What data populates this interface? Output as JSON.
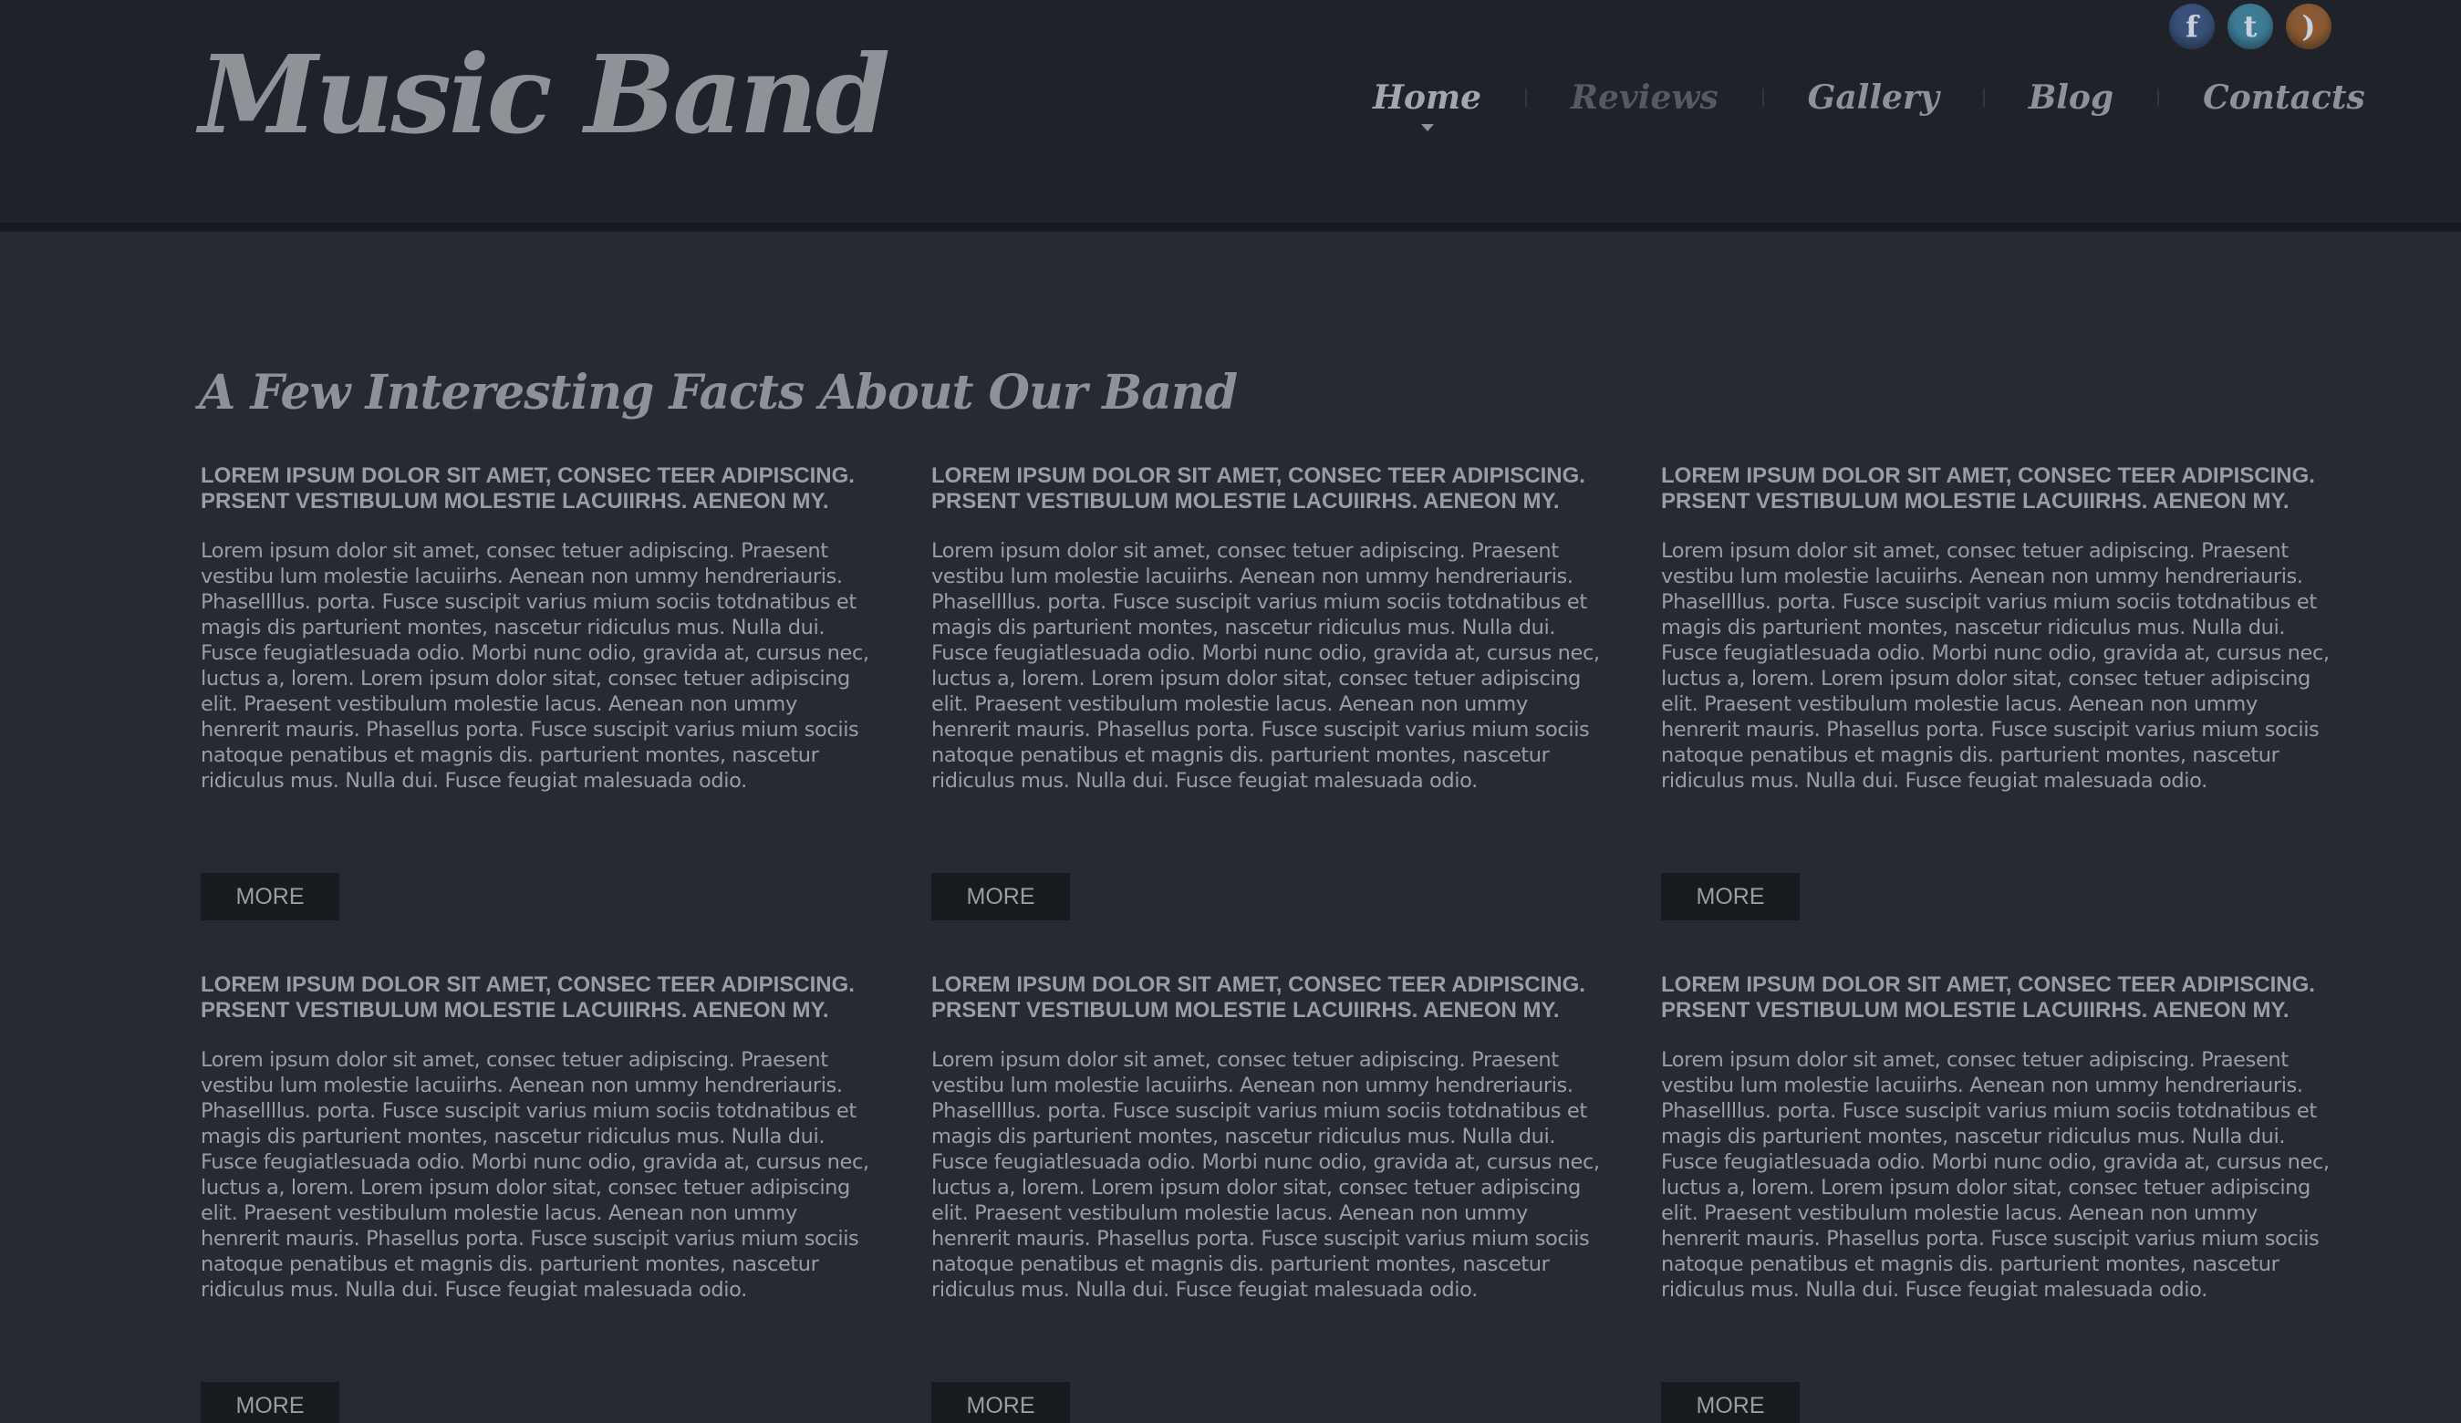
{
  "header": {
    "logo": "Music Band",
    "social": [
      {
        "icon": "facebook-icon",
        "glyph": "f"
      },
      {
        "icon": "twitter-icon",
        "glyph": "t"
      },
      {
        "icon": "rss-icon",
        "glyph": ")"
      }
    ],
    "nav": [
      {
        "label": "Home",
        "active": true
      },
      {
        "label": "Reviews",
        "active": false
      },
      {
        "label": "Gallery",
        "active": false
      },
      {
        "label": "Blog",
        "active": false
      },
      {
        "label": "Contacts",
        "active": false
      }
    ]
  },
  "main": {
    "heading": "A Few Interesting Facts About Our Band",
    "cards": [
      {
        "title": "LOREM IPSUM DOLOR SIT AMET, CONSEC TEER ADIPISCING. PRSENT VESTIBULUM MOLESTIE LACUIIRHS. AENEON MY.",
        "text": "Lorem ipsum dolor sit amet, consec tetuer adipiscing. Praesent vestibu lum molestie lacuiirhs. Aenean non ummy hendreriauris. Phasellllus. porta. Fusce suscipit varius mium sociis totdnatibus et magis dis parturient montes, nascetur ridiculus mus. Nulla dui. Fusce feugiatlesuada odio. Morbi nunc odio, gravida at, cursus nec, luctus a, lorem. Lorem ipsum dolor sitat, consec tetuer adipiscing elit. Praesent vestibulum molestie lacus. Aenean non ummy henrerit mauris. Phasellus porta. Fusce suscipit varius mium sociis natoque penatibus et magnis dis. parturient montes, nascetur ridiculus mus. Nulla dui. Fusce feugiat malesuada odio.",
        "button": "MORE"
      },
      {
        "title": "LOREM IPSUM DOLOR SIT AMET, CONSEC TEER ADIPISCING. PRSENT VESTIBULUM MOLESTIE LACUIIRHS. AENEON MY.",
        "text": "Lorem ipsum dolor sit amet, consec tetuer adipiscing. Praesent vestibu lum molestie lacuiirhs. Aenean non ummy hendreriauris. Phasellllus. porta. Fusce suscipit varius mium sociis totdnatibus et magis dis parturient montes, nascetur ridiculus mus. Nulla dui. Fusce feugiatlesuada odio. Morbi nunc odio, gravida at, cursus nec, luctus a, lorem. Lorem ipsum dolor sitat, consec tetuer adipiscing elit. Praesent vestibulum molestie lacus. Aenean non ummy henrerit mauris. Phasellus porta. Fusce suscipit varius mium sociis natoque penatibus et magnis dis. parturient montes, nascetur ridiculus mus. Nulla dui. Fusce feugiat malesuada odio.",
        "button": "MORE"
      },
      {
        "title": "LOREM IPSUM DOLOR SIT AMET, CONSEC TEER ADIPISCING. PRSENT VESTIBULUM MOLESTIE LACUIIRHS. AENEON MY.",
        "text": "Lorem ipsum dolor sit amet, consec tetuer adipiscing. Praesent vestibu lum molestie lacuiirhs. Aenean non ummy hendreriauris. Phasellllus. porta. Fusce suscipit varius mium sociis totdnatibus et magis dis parturient montes, nascetur ridiculus mus. Nulla dui. Fusce feugiatlesuada odio. Morbi nunc odio, gravida at, cursus nec, luctus a, lorem. Lorem ipsum dolor sitat, consec tetuer adipiscing elit. Praesent vestibulum molestie lacus. Aenean non ummy henrerit mauris. Phasellus porta. Fusce suscipit varius mium sociis natoque penatibus et magnis dis. parturient montes, nascetur ridiculus mus. Nulla dui. Fusce feugiat malesuada odio.",
        "button": "MORE"
      },
      {
        "title": "LOREM IPSUM DOLOR SIT AMET, CONSEC TEER ADIPISCING. PRSENT VESTIBULUM MOLESTIE LACUIIRHS. AENEON MY.",
        "text": "Lorem ipsum dolor sit amet, consec tetuer adipiscing. Praesent vestibu lum molestie lacuiirhs. Aenean non ummy hendreriauris. Phasellllus. porta. Fusce suscipit varius mium sociis totdnatibus et magis dis parturient montes, nascetur ridiculus mus. Nulla dui. Fusce feugiatlesuada odio. Morbi nunc odio, gravida at, cursus nec, luctus a, lorem. Lorem ipsum dolor sitat, consec tetuer adipiscing elit. Praesent vestibulum molestie lacus. Aenean non ummy henrerit mauris. Phasellus porta. Fusce suscipit varius mium sociis natoque penatibus et magnis dis. parturient montes, nascetur ridiculus mus. Nulla dui. Fusce feugiat malesuada odio.",
        "button": "MORE"
      },
      {
        "title": "LOREM IPSUM DOLOR SIT AMET, CONSEC TEER ADIPISCING. PRSENT VESTIBULUM MOLESTIE LACUIIRHS. AENEON MY.",
        "text": "Lorem ipsum dolor sit amet, consec tetuer adipiscing. Praesent vestibu lum molestie lacuiirhs. Aenean non ummy hendreriauris. Phasellllus. porta. Fusce suscipit varius mium sociis totdnatibus et magis dis parturient montes, nascetur ridiculus mus. Nulla dui. Fusce feugiatlesuada odio. Morbi nunc odio, gravida at, cursus nec, luctus a, lorem. Lorem ipsum dolor sitat, consec tetuer adipiscing elit. Praesent vestibulum molestie lacus. Aenean non ummy henrerit mauris. Phasellus porta. Fusce suscipit varius mium sociis natoque penatibus et magnis dis. parturient montes, nascetur ridiculus mus. Nulla dui. Fusce feugiat malesuada odio.",
        "button": "MORE"
      },
      {
        "title": "LOREM IPSUM DOLOR SIT AMET, CONSEC TEER ADIPISCING. PRSENT VESTIBULUM MOLESTIE LACUIIRHS. AENEON MY.",
        "text": "Lorem ipsum dolor sit amet, consec tetuer adipiscing. Praesent vestibu lum molestie lacuiirhs. Aenean non ummy hendreriauris. Phasellllus. porta. Fusce suscipit varius mium sociis totdnatibus et magis dis parturient montes, nascetur ridiculus mus. Nulla dui. Fusce feugiatlesuada odio. Morbi nunc odio, gravida at, cursus nec, luctus a, lorem. Lorem ipsum dolor sitat, consec tetuer adipiscing elit. Praesent vestibulum molestie lacus. Aenean non ummy henrerit mauris. Phasellus porta. Fusce suscipit varius mium sociis natoque penatibus et magnis dis. parturient montes, nascetur ridiculus mus. Nulla dui. Fusce feugiat malesuada odio.",
        "button": "MORE"
      }
    ]
  }
}
